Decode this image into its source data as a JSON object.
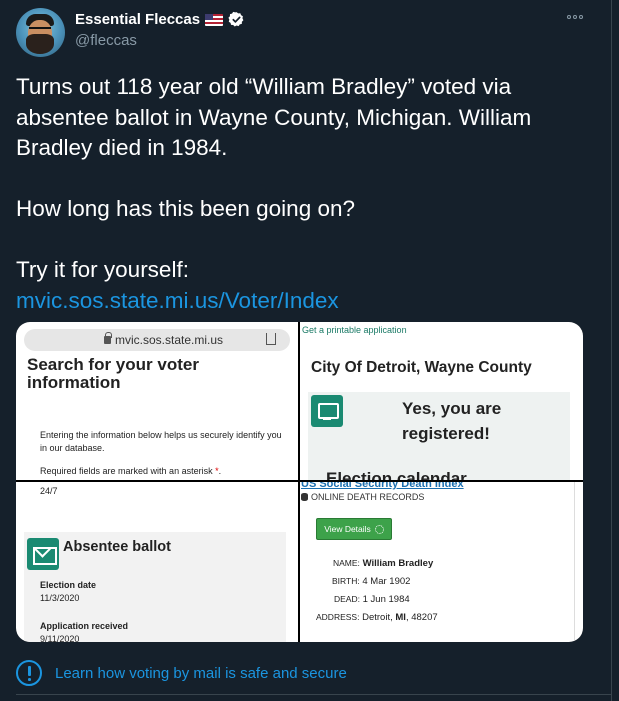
{
  "author": {
    "display_name": "Essential Fleccas",
    "handle": "@fleccas",
    "avatar_icon": "avatar-bearded-man",
    "flag_icon": "us-flag-icon",
    "verified_icon": "verified-badge-icon"
  },
  "tweet": {
    "text": "Turns out 118 year old “William Bradley” voted via absentee ballot in Wayne County, Michigan. William Bradley died in 1984.\n\nHow long has this been going on?\n\nTry it for yourself:",
    "link": "mvic.sos.state.mi.us/Voter/Index"
  },
  "media": {
    "pane1": {
      "url": "mvic.sos.state.mi.us",
      "title": "Search for your voter information",
      "paragraph": "Entering the information below helps us securely identify you in our database.",
      "required": "Required fields are marked with an asterisk",
      "asterisk": "*",
      "period": "."
    },
    "pane2": {
      "top_link": "Get a printable application",
      "city": "City Of Detroit, Wayne County",
      "registered": "Yes, you are registered!",
      "election_partial": "Election calendar"
    },
    "pane3": {
      "time": "24/7",
      "absentee_title": "Absentee ballot",
      "election_date_label": "Election date",
      "election_date_value": "11/3/2020",
      "app_received_label": "Application received",
      "app_received_value": "9/11/2020"
    },
    "pane4": {
      "header": "US Social Security Death Index",
      "subheader": "ONLINE DEATH RECORDS",
      "button": "View Details",
      "name_label": "NAME:",
      "name_value": "William Bradley",
      "birth_label": "BIRTH:",
      "birth_value": "4 Mar 1902",
      "dead_label": "DEAD:",
      "dead_value": "1 Jun 1984",
      "address_label": "ADDRESS:",
      "address_value_city": "Detroit,",
      "address_value_state": "MI",
      "address_value_zip": ", 48207"
    }
  },
  "footer": {
    "info_link": "Learn how voting by mail is safe and secure"
  },
  "colors": {
    "background": "#15202b",
    "link": "#1b95e0",
    "secondary_text": "#8899a6",
    "badge_green": "#1a8a72"
  }
}
